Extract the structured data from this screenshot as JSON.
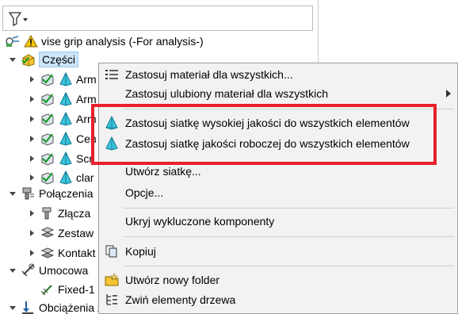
{
  "tree": {
    "root_label": "vise grip analysis (-For analysis-)",
    "parts_label": "Części",
    "parts": [
      "Arm",
      "Arm",
      "Arm",
      "Cen",
      "Scr",
      "clar"
    ],
    "connections_label": "Połączenia",
    "joints_label": "Złącza",
    "sets_label": "Zestaw",
    "contacts_label": "Kontakt",
    "fixtures_label": "Umocowa",
    "fixed_label": "Fixed-1",
    "loads_label": "Obciążenia zewnętrzne"
  },
  "menu": {
    "apply_material_all": "Zastosuj materiał dla wszystkich...",
    "apply_fav_material_all": "Zastosuj ulubiony materiał dla wszystkich",
    "apply_high_quality_mesh": "Zastosuj siatkę wysokiej jakości do wszystkich elementów",
    "apply_draft_mesh": "Zastosuj siatkę jakości roboczej do wszystkich elementów",
    "create_mesh": "Utwórz siatkę...",
    "options": "Opcje...",
    "hide_excluded": "Ukryj wykluczone komponenty",
    "copy": "Kopiuj",
    "new_folder": "Utwórz nowy folder",
    "collapse": "Zwiń elementy drzewa"
  },
  "colors": {
    "highlight": "#e8202a",
    "selection": "#cce4f7",
    "mesh_cyan": "#3cc3dc"
  }
}
